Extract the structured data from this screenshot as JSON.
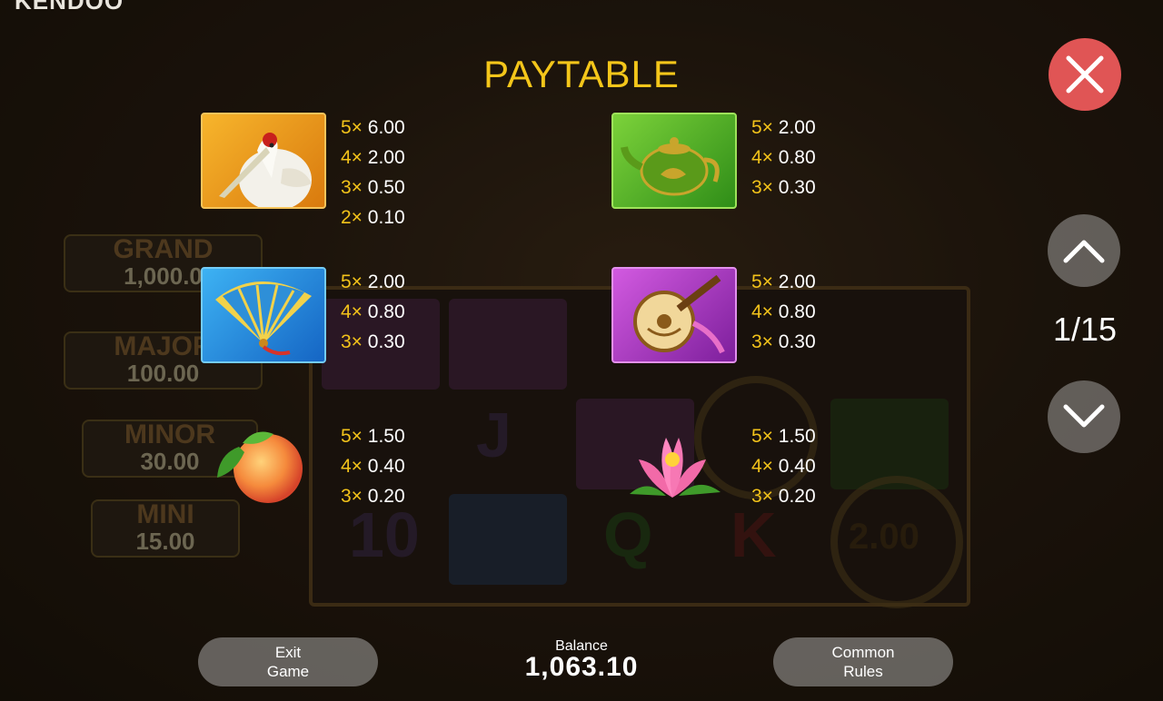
{
  "brand": {
    "logo_text": "KENDOO"
  },
  "title": "PAYTABLE",
  "background": {
    "jackpots": [
      {
        "name": "GRAND",
        "value": "1,000.0"
      },
      {
        "name": "MAJOR",
        "value": "100.00"
      },
      {
        "name": "MINOR",
        "value": "30.00"
      },
      {
        "name": "MINI",
        "value": "15.00"
      }
    ],
    "coin_value": "2.00"
  },
  "symbols": [
    {
      "icon": "crane-icon",
      "payouts": [
        {
          "count": "5×",
          "value": "6.00"
        },
        {
          "count": "4×",
          "value": "2.00"
        },
        {
          "count": "3×",
          "value": "0.50"
        },
        {
          "count": "2×",
          "value": "0.10"
        }
      ]
    },
    {
      "icon": "teapot-icon",
      "payouts": [
        {
          "count": "5×",
          "value": "2.00"
        },
        {
          "count": "4×",
          "value": "0.80"
        },
        {
          "count": "3×",
          "value": "0.30"
        }
      ]
    },
    {
      "icon": "fan-icon",
      "payouts": [
        {
          "count": "5×",
          "value": "2.00"
        },
        {
          "count": "4×",
          "value": "0.80"
        },
        {
          "count": "3×",
          "value": "0.30"
        }
      ]
    },
    {
      "icon": "lute-icon",
      "payouts": [
        {
          "count": "5×",
          "value": "2.00"
        },
        {
          "count": "4×",
          "value": "0.80"
        },
        {
          "count": "3×",
          "value": "0.30"
        }
      ]
    },
    {
      "icon": "peach-icon",
      "payouts": [
        {
          "count": "5×",
          "value": "1.50"
        },
        {
          "count": "4×",
          "value": "0.40"
        },
        {
          "count": "3×",
          "value": "0.20"
        }
      ]
    },
    {
      "icon": "lotus-icon",
      "payouts": [
        {
          "count": "5×",
          "value": "1.50"
        },
        {
          "count": "4×",
          "value": "0.40"
        },
        {
          "count": "3×",
          "value": "0.20"
        }
      ]
    }
  ],
  "controls": {
    "close_icon": "close-icon",
    "up_icon": "chevron-up-icon",
    "down_icon": "chevron-down-icon",
    "page_current": "1",
    "page_separator": "/",
    "page_total": "15"
  },
  "footer": {
    "exit_line1": "Exit",
    "exit_line2": "Game",
    "balance_label": "Balance",
    "balance_value": "1,063.10",
    "rules_line1": "Common",
    "rules_line2": "Rules"
  },
  "colors": {
    "accent": "#f2c21a",
    "close": "#e05555"
  }
}
